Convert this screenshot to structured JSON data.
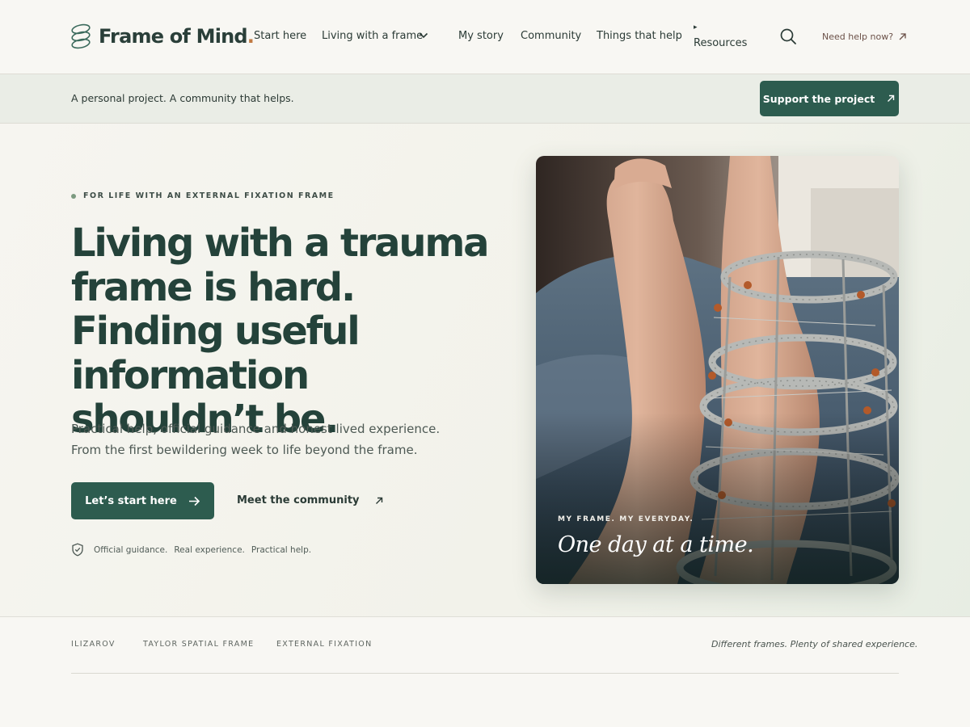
{
  "brand": {
    "name": "Frame of Mind",
    "dot": "."
  },
  "nav": {
    "items": [
      "Start here",
      "Living with a frame",
      "My story",
      "Community",
      "Things that help"
    ],
    "resources_marker": "▸",
    "resources": "Resources",
    "help": "Need help now?"
  },
  "strip": {
    "text": "A personal project. A community that helps.",
    "support_label": "Support the project"
  },
  "hero": {
    "eyebrow": "FOR LIFE WITH AN EXTERNAL FIXATION FRAME",
    "headline": "Living with a trauma frame is hard. Finding useful information shouldn’t be.",
    "lede_1": "Practical help, official guidance and honest lived experience.",
    "lede_2": "From the first bewildering week to life beyond the frame.",
    "cta_primary": "Let’s start here",
    "cta_secondary": "Meet the community",
    "trust": [
      "Official guidance.",
      "Real experience.",
      "Practical help."
    ]
  },
  "photo": {
    "eyebrow": "MY FRAME. MY EVERYDAY.",
    "caption": "One day at a time."
  },
  "frames": {
    "tags": [
      "ILIZAROV",
      "TAYLOR SPATIAL FRAME",
      "EXTERNAL FIXATION"
    ],
    "tagline": "Different frames. Plenty of shared experience."
  },
  "colors": {
    "accent": "#2d5c4f",
    "text": "#24423a",
    "brand_dot": "#c07a43"
  },
  "icons": [
    "logo-mark-icon",
    "chevron-down-icon",
    "search-icon",
    "arrow-up-right-icon",
    "arrow-right-icon",
    "shield-check-icon"
  ]
}
